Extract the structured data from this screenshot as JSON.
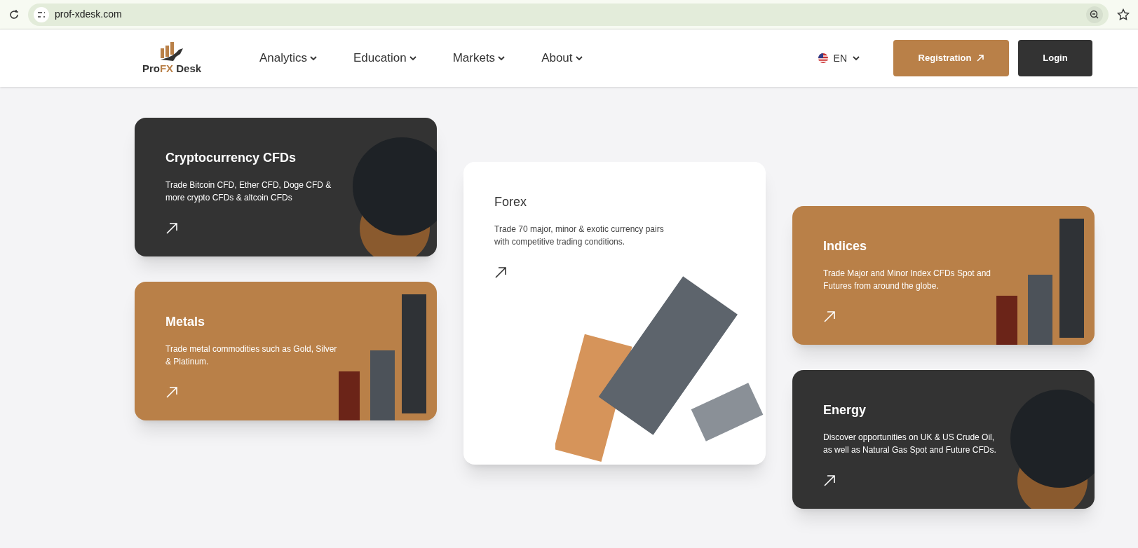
{
  "browser": {
    "url": "prof-xdesk.com"
  },
  "header": {
    "logo": [
      {
        "text": "Pro",
        "accent": false
      },
      {
        "text": "FX",
        "accent": true
      },
      {
        "text": " Desk",
        "accent": false
      }
    ],
    "nav": [
      "Analytics",
      "Education",
      "Markets",
      "About"
    ],
    "language": "EN",
    "register": "Registration",
    "login": "Login"
  },
  "columns": [
    [
      {
        "kind": "dark",
        "title": "Cryptocurrency CFDs",
        "text": "Trade Bitcoin CFD, Ether CFD, Doge CFD & more crypto CFDs & altcoin CFDs"
      },
      {
        "kind": "brown",
        "title": "Metals",
        "text": "Trade metal commodities such as Gold, Silver & Platinum."
      }
    ],
    [
      {
        "kind": "light",
        "title": "Forex",
        "text": "Trade 70 major, minor & exotic currency pairs with competitive trading conditions."
      }
    ],
    [
      {
        "kind": "brown",
        "title": "Indices",
        "text": "Trade Major and Minor Index CFDs Spot and Futures from around the globe."
      },
      {
        "kind": "dark",
        "title": "Energy",
        "text": "Discover opportunities on UK & US Crude Oil, as well as Natural Gas Spot and Future CFDs."
      }
    ]
  ]
}
